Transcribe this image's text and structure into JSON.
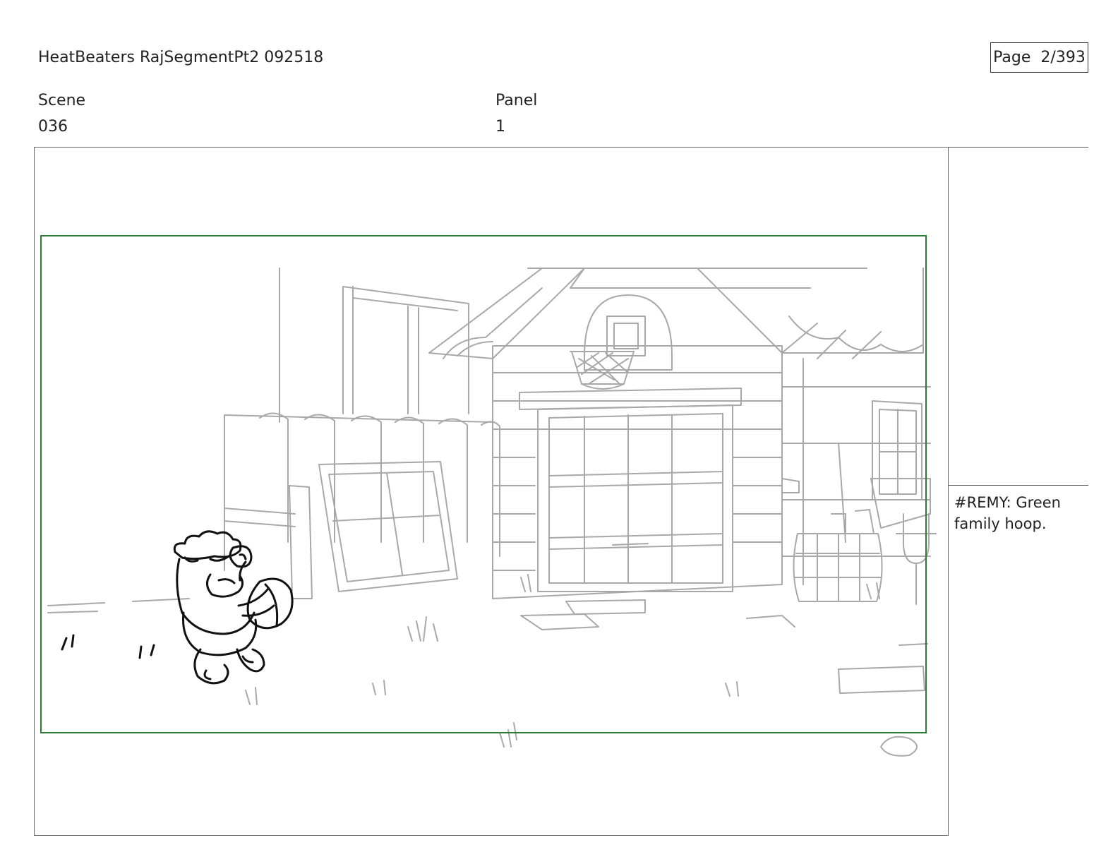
{
  "header": {
    "title": "HeatBeaters RajSegmentPt2 092518",
    "page_label": "Page",
    "page_number": "2/393"
  },
  "fields": {
    "scene_label": "Scene",
    "scene_value": "036",
    "panel_label": "Panel",
    "panel_value": "1"
  },
  "notes": {
    "dialogue": "#REMY:  Green family hoop."
  },
  "colors": {
    "safe_frame": "#2e7d32",
    "background_lines": "#9e9e9e",
    "character_lines": "#111111"
  }
}
